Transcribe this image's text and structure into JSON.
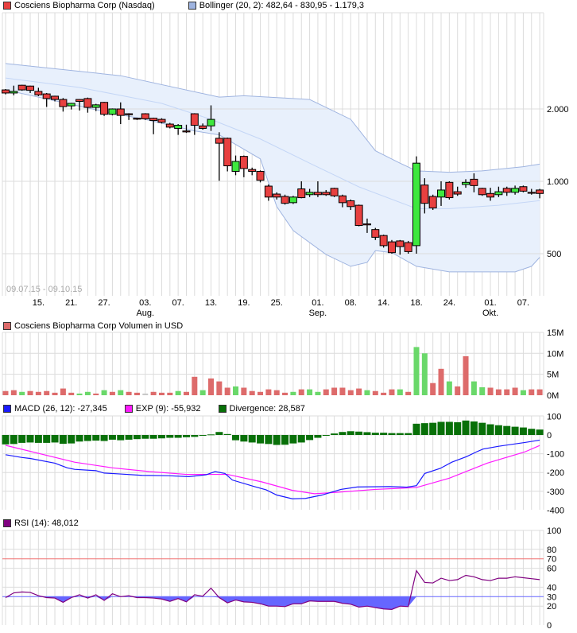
{
  "legends": {
    "price": {
      "label": "Cosciens Biopharma Corp (Nasdaq)",
      "color": "#e84040"
    },
    "bollinger": {
      "label": "Bollinger (20, 2): 482,64 - 830,95 - 1.179,3",
      "color": "#9fb4e0"
    },
    "volume": {
      "label": "Cosciens Biopharma Corp Volumen in USD",
      "color": "#dd6b6b"
    },
    "macd": {
      "label": "MACD (26, 12): -27,345",
      "color": "#1a1aff"
    },
    "exp": {
      "label": "EXP (9): -55,932",
      "color": "#ff1aff"
    },
    "divergence": {
      "label": "Divergence: 28,587",
      "color": "#087008"
    },
    "rsi": {
      "label": "RSI (14): 48,012",
      "color": "#800080"
    }
  },
  "date_range": "09.07.15 - 09.10.15",
  "chart_data": [
    {
      "type": "candlestick",
      "title": "Cosciens Biopharma Corp (Nasdaq)",
      "yscale": "log",
      "yticks": [
        {
          "value": 2000,
          "label": "2.000"
        },
        {
          "value": 1000,
          "label": "1.000"
        },
        {
          "value": 500,
          "label": "500"
        }
      ],
      "xticks": [
        {
          "index": 4,
          "label": "15.",
          "month": ""
        },
        {
          "index": 8,
          "label": "21.",
          "month": ""
        },
        {
          "index": 12,
          "label": "27.",
          "month": ""
        },
        {
          "index": 17,
          "label": "03.",
          "month": "Aug."
        },
        {
          "index": 21,
          "label": "07.",
          "month": ""
        },
        {
          "index": 25,
          "label": "13.",
          "month": ""
        },
        {
          "index": 29,
          "label": "19.",
          "month": ""
        },
        {
          "index": 33,
          "label": "25.",
          "month": ""
        },
        {
          "index": 38,
          "label": "01.",
          "month": "Sep."
        },
        {
          "index": 42,
          "label": "08.",
          "month": ""
        },
        {
          "index": 46,
          "label": "14.",
          "month": ""
        },
        {
          "index": 50,
          "label": "18.",
          "month": ""
        },
        {
          "index": 54,
          "label": "24.",
          "month": ""
        },
        {
          "index": 59,
          "label": "01.",
          "month": "Okt."
        },
        {
          "index": 63,
          "label": "07.",
          "month": ""
        }
      ],
      "ohlc": [
        [
          2400,
          2420,
          2300,
          2330
        ],
        [
          2330,
          2500,
          2280,
          2366
        ],
        [
          2510,
          2520,
          2380,
          2400
        ],
        [
          2490,
          2500,
          2330,
          2390
        ],
        [
          2366,
          2450,
          2260,
          2290
        ],
        [
          2310,
          2330,
          2040,
          2210
        ],
        [
          2260,
          2270,
          2150,
          2190
        ],
        [
          2190,
          2220,
          1950,
          2045
        ],
        [
          2060,
          2120,
          1990,
          2110
        ],
        [
          2190,
          2200,
          1970,
          2150
        ],
        [
          2210,
          2230,
          1930,
          2030
        ],
        [
          2030,
          2100,
          1960,
          2080
        ],
        [
          2130,
          2140,
          1870,
          1900
        ],
        [
          1900,
          2010,
          1880,
          2000
        ],
        [
          2000,
          2130,
          1730,
          1880
        ],
        [
          1910,
          1920,
          1800,
          1905
        ],
        [
          1830,
          1840,
          1800,
          1825
        ],
        [
          1910,
          1920,
          1800,
          1820
        ],
        [
          1830,
          1840,
          1570,
          1790
        ],
        [
          1810,
          1830,
          1740,
          1760
        ],
        [
          1730,
          1750,
          1660,
          1680
        ],
        [
          1660,
          1730,
          1560,
          1710
        ],
        [
          1620,
          1720,
          1590,
          1615
        ],
        [
          1910,
          1920,
          1560,
          1710
        ],
        [
          1700,
          1740,
          1640,
          1660
        ],
        [
          1700,
          2070,
          1620,
          1810
        ],
        [
          1510,
          1600,
          1005,
          1440
        ],
        [
          1510,
          1520,
          1100,
          1160
        ],
        [
          1100,
          1280,
          1060,
          1210
        ],
        [
          1270,
          1280,
          1040,
          1130
        ],
        [
          1120,
          1140,
          1060,
          1100
        ],
        [
          1100,
          1110,
          990,
          1010
        ],
        [
          955,
          970,
          830,
          860
        ],
        [
          885,
          900,
          840,
          860
        ],
        [
          865,
          880,
          800,
          810
        ],
        [
          815,
          870,
          805,
          860
        ],
        [
          930,
          1000,
          850,
          855
        ],
        [
          880,
          930,
          860,
          900
        ],
        [
          900,
          1000,
          860,
          880
        ],
        [
          900,
          920,
          870,
          880
        ],
        [
          935,
          940,
          860,
          870
        ],
        [
          870,
          880,
          780,
          815
        ],
        [
          830,
          840,
          760,
          785
        ],
        [
          795,
          800,
          650,
          655
        ],
        [
          665,
          700,
          610,
          663
        ],
        [
          630,
          640,
          570,
          585
        ],
        [
          595,
          600,
          530,
          540
        ],
        [
          560,
          570,
          500,
          505
        ],
        [
          565,
          570,
          495,
          535
        ],
        [
          556,
          565,
          500,
          510
        ],
        [
          540,
          1270,
          500,
          1190
        ],
        [
          965,
          1030,
          735,
          810
        ],
        [
          865,
          880,
          760,
          775
        ],
        [
          860,
          1000,
          790,
          920
        ],
        [
          990,
          1000,
          840,
          855
        ],
        [
          905,
          950,
          870,
          885
        ],
        [
          970,
          1020,
          940,
          990
        ],
        [
          1020,
          1080,
          900,
          960
        ],
        [
          935,
          940,
          870,
          880
        ],
        [
          890,
          940,
          830,
          860
        ],
        [
          880,
          950,
          860,
          905
        ],
        [
          935,
          950,
          870,
          900
        ],
        [
          900,
          960,
          880,
          935
        ],
        [
          950,
          960,
          900,
          910
        ],
        [
          900,
          930,
          880,
          899
        ],
        [
          920,
          930,
          850,
          890
        ]
      ],
      "bollinger": {
        "upper": [
          [
            0,
            3090
          ],
          [
            14,
            2750
          ],
          [
            26,
            2240
          ],
          [
            29,
            2270
          ],
          [
            37,
            2190
          ],
          [
            42,
            1810
          ],
          [
            45,
            1340
          ],
          [
            48,
            1190
          ],
          [
            50,
            1105
          ],
          [
            54,
            1090
          ],
          [
            58,
            1105
          ],
          [
            63,
            1150
          ],
          [
            65,
            1179.3
          ]
        ],
        "middle": [
          [
            0,
            2690
          ],
          [
            9,
            2457
          ],
          [
            19,
            2110
          ],
          [
            25,
            1810
          ],
          [
            31,
            1500
          ],
          [
            37,
            1190
          ],
          [
            43,
            948
          ],
          [
            50,
            770
          ],
          [
            54,
            770
          ],
          [
            60,
            795
          ],
          [
            65,
            830.95
          ]
        ],
        "lower": [
          [
            0,
            2400
          ],
          [
            12,
            1950
          ],
          [
            17,
            1810
          ],
          [
            23,
            1620
          ],
          [
            26,
            1560
          ],
          [
            31,
            1240
          ],
          [
            33,
            785
          ],
          [
            35,
            624
          ],
          [
            39,
            496
          ],
          [
            42,
            443
          ],
          [
            44,
            460
          ],
          [
            45,
            515
          ],
          [
            47,
            505
          ],
          [
            50,
            443
          ],
          [
            54,
            420
          ],
          [
            62,
            420
          ],
          [
            64,
            443
          ],
          [
            65,
            482.64
          ]
        ]
      }
    },
    {
      "type": "bar",
      "title": "Cosciens Biopharma Corp Volumen in USD",
      "unit": "M",
      "yticks": [
        {
          "value": 15,
          "label": "15M"
        },
        {
          "value": 10,
          "label": "10M"
        },
        {
          "value": 5,
          "label": "5M"
        },
        {
          "value": 0,
          "label": "0M"
        }
      ],
      "values": [
        1.0,
        1.2,
        0.8,
        1.0,
        0.8,
        1.0,
        0.6,
        1.6,
        0.6,
        0.4,
        0.8,
        0.4,
        1.2,
        0.8,
        1.2,
        0.8,
        0.6,
        0.4,
        0.8,
        0.6,
        0.6,
        1.0,
        0.8,
        4.4,
        1.2,
        4.0,
        3.3,
        1.8,
        2.1,
        1.8,
        1.0,
        0.8,
        1.4,
        1.2,
        0.6,
        0.8,
        1.4,
        1.4,
        0.8,
        1.4,
        1.8,
        1.8,
        1.2,
        1.6,
        1.2,
        1.0,
        0.6,
        1.4,
        1.4,
        0.8,
        11.5,
        10.0,
        2.9,
        6.3,
        3.3,
        2.1,
        9.3,
        3.3,
        1.9,
        1.8,
        1.4,
        1.4,
        1.8,
        1.2,
        1.4,
        1.4
      ],
      "direction": "ddudddddduudududdfddduddudddudddddduduuddddduddduduuddudduudddduddd"
    },
    {
      "type": "line",
      "title": "MACD",
      "yticks": [
        100,
        0,
        -100,
        -200,
        -300,
        -400
      ],
      "divergence": [
        -50,
        -48,
        -42,
        -40,
        -42,
        -42,
        -40,
        -47,
        -45,
        -35,
        -32,
        -30,
        -32,
        -25,
        -28,
        -25,
        -22,
        -20,
        -20,
        -18,
        -15,
        -15,
        -12,
        -10,
        -3,
        3,
        16,
        5,
        -28,
        -35,
        -40,
        -45,
        -48,
        -53,
        -52,
        -45,
        -40,
        -27,
        -15,
        -2,
        8,
        16,
        20,
        18,
        15,
        12,
        12,
        10,
        10,
        10,
        60,
        63,
        65,
        70,
        70,
        68,
        77,
        72,
        65,
        57,
        52,
        48,
        44,
        40,
        33,
        29
      ],
      "macd": [
        [
          0,
          -105
        ],
        [
          2,
          -120
        ],
        [
          3,
          -125
        ],
        [
          6,
          -150
        ],
        [
          7.5,
          -175
        ],
        [
          8.4,
          -183
        ],
        [
          11,
          -190
        ],
        [
          12,
          -203
        ],
        [
          14,
          -208
        ],
        [
          16.6,
          -215
        ],
        [
          19.8,
          -217
        ],
        [
          22.3,
          -222
        ],
        [
          24.4,
          -212
        ],
        [
          25.5,
          -195
        ],
        [
          26.7,
          -205
        ],
        [
          27.6,
          -240
        ],
        [
          30.3,
          -275
        ],
        [
          31.7,
          -292
        ],
        [
          33,
          -320
        ],
        [
          34.9,
          -340
        ],
        [
          36.5,
          -338
        ],
        [
          38.5,
          -320
        ],
        [
          40.8,
          -290
        ],
        [
          42.8,
          -277
        ],
        [
          46.7,
          -275
        ],
        [
          48.8,
          -278
        ],
        [
          50,
          -270
        ],
        [
          51,
          -205
        ],
        [
          52.9,
          -178
        ],
        [
          54.3,
          -145
        ],
        [
          56.1,
          -115
        ],
        [
          57.3,
          -90
        ],
        [
          58.1,
          -75
        ],
        [
          60,
          -60
        ],
        [
          63.2,
          -40
        ],
        [
          65,
          -27.345
        ]
      ],
      "exp": [
        [
          0,
          -55
        ],
        [
          8.4,
          -145
        ],
        [
          13,
          -175
        ],
        [
          17.5,
          -195
        ],
        [
          22,
          -210
        ],
        [
          25.7,
          -210
        ],
        [
          27,
          -210
        ],
        [
          31.2,
          -250
        ],
        [
          34.9,
          -295
        ],
        [
          37.6,
          -313
        ],
        [
          40.4,
          -305
        ],
        [
          45,
          -290
        ],
        [
          50,
          -280
        ],
        [
          54,
          -230
        ],
        [
          58.6,
          -150
        ],
        [
          63.2,
          -90
        ],
        [
          65,
          -55.932
        ]
      ]
    },
    {
      "type": "line",
      "title": "RSI (14)",
      "yticks": [
        {
          "value": 100,
          "label": "100"
        },
        {
          "value": 80,
          "label": "80"
        },
        {
          "value": 70,
          "label": "70"
        },
        {
          "value": 60,
          "label": "60"
        },
        {
          "value": 40,
          "label": "40"
        },
        {
          "value": 30,
          "label": "30"
        },
        {
          "value": 20,
          "label": "20"
        },
        {
          "value": 0,
          "label": "0"
        }
      ],
      "overbought": 70,
      "oversold": 30,
      "values": [
        29,
        34,
        35,
        34.5,
        31,
        29,
        28.5,
        24,
        29,
        32,
        28.5,
        32,
        26,
        33,
        30,
        31,
        29,
        29,
        28.5,
        27.5,
        25,
        28,
        24.5,
        32,
        30.5,
        39,
        29,
        23.5,
        26.5,
        24.5,
        24,
        22.5,
        20,
        20,
        19.5,
        22.5,
        22.5,
        25.5,
        25,
        25,
        25,
        23,
        22,
        19,
        20,
        18.5,
        17,
        16.5,
        20,
        19.5,
        57.5,
        45,
        44.5,
        49.5,
        47,
        48,
        52.5,
        51,
        48,
        47,
        49.5,
        49.5,
        51,
        50,
        49,
        48.012
      ]
    }
  ],
  "colors": {
    "up": "#3ee83e",
    "down": "#e84040",
    "volUp": "#6ad86a",
    "volDown": "#dd6b6b",
    "volFlat": "#c8c8c8",
    "bandFill": "#e8f0fc",
    "bandLine": "#9fb4e0",
    "bandMid": "#c4d6f6",
    "grid": "#dcdcdc",
    "rsiFill": "#6666ff",
    "rsiHigh": "#f07070"
  }
}
